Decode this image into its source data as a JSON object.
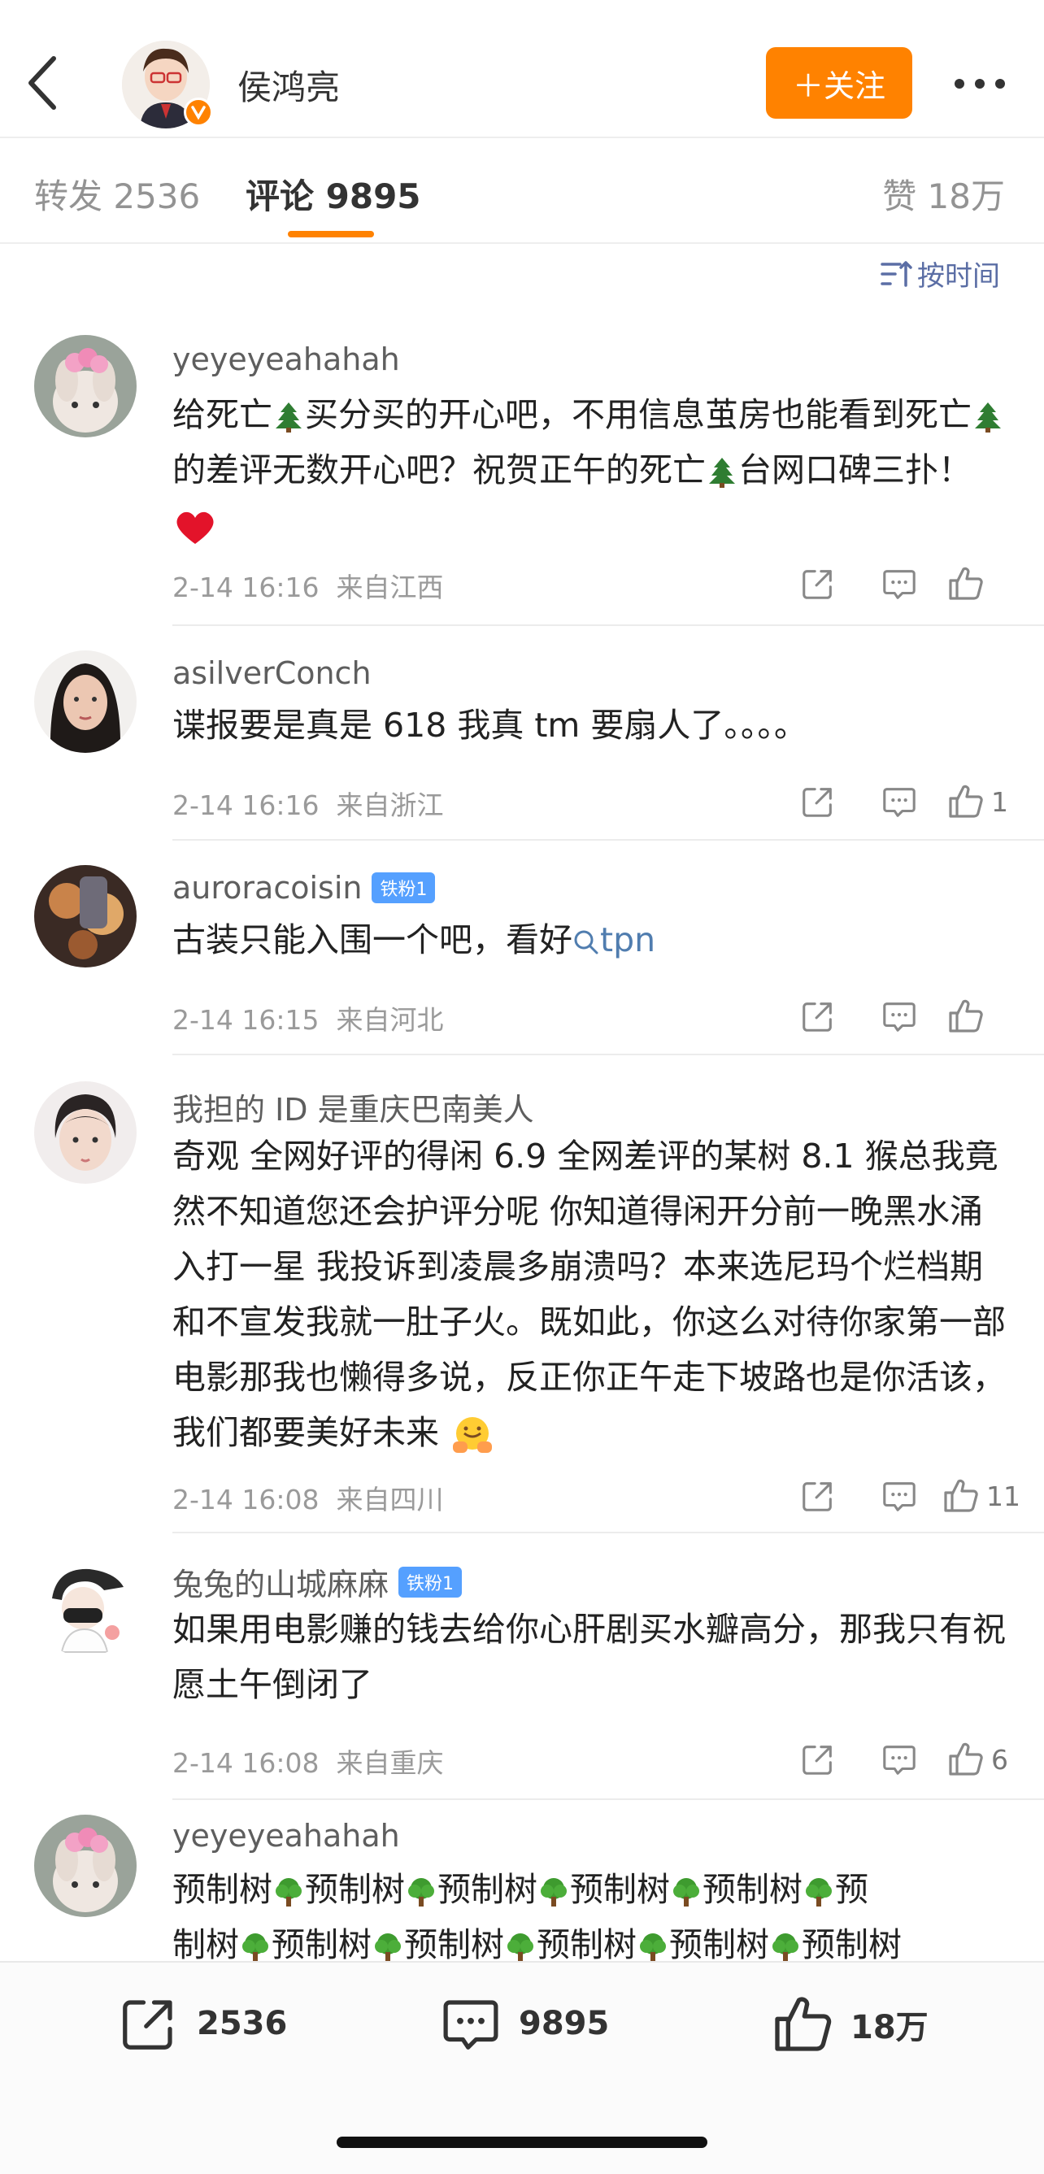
{
  "header": {
    "username": "侯鸿亮",
    "follow_label": "＋关注"
  },
  "tabs": {
    "repost": "转发 2536",
    "comment": "评论 9895",
    "likes": "赞 18万"
  },
  "sort_label": "按时间",
  "comments": [
    {
      "user": "yeyeyeahahah",
      "badge": "",
      "text_parts": [
        "给死亡",
        "买分买的开心吧，不用信息茧房也能看到死亡",
        "的差评无数开心吧？祝贺正午的死亡",
        "台网口碑三扑！"
      ],
      "time": "2-14 16:16",
      "location": "来自江西",
      "likes": ""
    },
    {
      "user": "asilverConch",
      "badge": "",
      "text": "谍报要是真是 618 我真 tm 要扇人了。。。。",
      "time": "2-14 16:16",
      "location": "来自浙江",
      "likes": "1"
    },
    {
      "user": "auroracoisin",
      "badge": "铁粉1",
      "text": "古装只能入围一个吧，看好",
      "link": "tpn",
      "time": "2-14 16:15",
      "location": "来自河北",
      "likes": ""
    },
    {
      "user": "我担的 ID 是重庆巴南美人",
      "badge": "",
      "text": "奇观 全网好评的得闲 6.9 全网差评的某树 8.1 猴总我竟然不知道您还会护评分呢 你知道得闲开分前一晚黑水涌入打一星 我投诉到凌晨多崩溃吗？本来选尼玛个烂档期和不宣发我就一肚子火。既如此，你这么对待你家第一部电影那我也懒得多说，反正你正午走下坡路也是你活该，我们都要美好未来",
      "time": "2-14 16:08",
      "location": "来自四川",
      "likes": "11"
    },
    {
      "user": "兔兔的山城麻麻",
      "badge": "铁粉1",
      "text": "如果用电影赚的钱去给你心肝剧买水瓣高分，那我只有祝愿土午倒闭了",
      "time": "2-14 16:08",
      "location": "来自重庆",
      "likes": "6"
    },
    {
      "user": "yeyeyeahahah",
      "badge": "",
      "word": "预制树",
      "line1_tail": "预",
      "line2_head": "制树",
      "time": "",
      "location": "",
      "likes": ""
    }
  ],
  "bottom_bar": {
    "repost_count": "2536",
    "comment_count": "9895",
    "like_count": "18万"
  },
  "icons": {
    "back": "chevron-left-icon",
    "more": "more-dots-icon",
    "sort": "sort-icon",
    "share": "share-icon",
    "comment": "comment-icon",
    "like": "thumb-up-icon",
    "tree": "evergreen-tree-emoji",
    "tree2": "deciduous-tree-emoji",
    "heart": "red-heart-emoji",
    "hug": "hugging-face-emoji"
  },
  "colors": {
    "accent": "#ff8200",
    "link": "#507daf",
    "badge": "#55a0ff"
  }
}
